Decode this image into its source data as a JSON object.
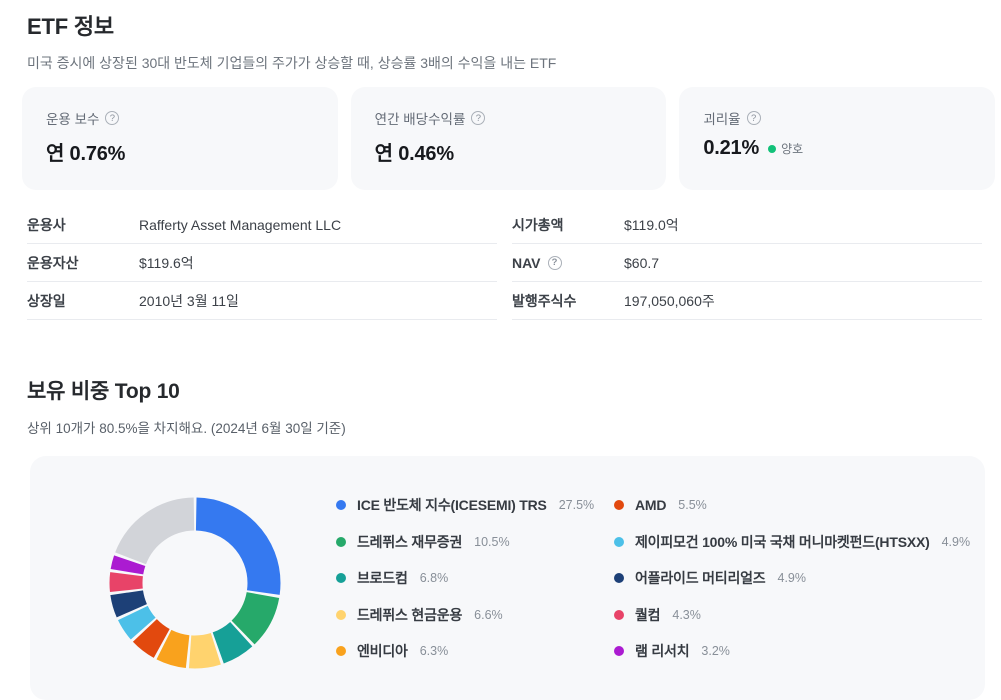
{
  "page": {
    "title": "ETF 정보",
    "subtitle": "미국 증시에 상장된 30대 반도체 기업들의 주가가 상승할 때, 상승률 3배의 수익을 내는 ETF"
  },
  "stat_cards": [
    {
      "label": "운용 보수",
      "value": "연 0.76%"
    },
    {
      "label": "연간 배당수익률",
      "value": "연 0.46%"
    },
    {
      "label": "괴리율",
      "value": "0.21%",
      "badge": {
        "text": "양호",
        "color": "#12c179"
      }
    }
  ],
  "info_table": {
    "left": [
      {
        "label": "운용사",
        "value": "Rafferty Asset Management LLC"
      },
      {
        "label": "운용자산",
        "value": "$119.6억"
      },
      {
        "label": "상장일",
        "value": "2010년 3월 11일"
      }
    ],
    "right": [
      {
        "label": "시가총액",
        "value": "$119.0억"
      },
      {
        "label": "NAV",
        "value": "$60.7",
        "has_help": true
      },
      {
        "label": "발행주식수",
        "value": "197,050,060주"
      }
    ]
  },
  "holdings": {
    "title": "보유 비중 Top 10",
    "subtitle": "상위 10개가 80.5%을 차지해요. (2024년 6월 30일 기준)"
  },
  "chart_data": {
    "type": "pie",
    "donut": true,
    "title": "보유 비중 Top 10",
    "legend_position": "right",
    "start_angle_deg": 0,
    "direction": "clockwise",
    "labels": [
      "ICE 반도체 지수(ICESEMI) TRS",
      "드레퓌스 재무증권",
      "브로드컴",
      "드레퓌스 현금운용",
      "엔비디아",
      "AMD",
      "제이피모건 100% 미국 국채 머니마켓펀드(HTSXX)",
      "어플라이드 머티리얼즈",
      "퀄컴",
      "램 리서치"
    ],
    "values": [
      27.5,
      10.5,
      6.8,
      6.6,
      6.3,
      5.5,
      4.9,
      4.9,
      4.3,
      3.2
    ],
    "colors": [
      "#3579f0",
      "#26a96a",
      "#16a097",
      "#ffd36e",
      "#f9a21d",
      "#e2490e",
      "#4cc0e8",
      "#1d4077",
      "#e84368",
      "#ab1bd1"
    ],
    "remainder": {
      "value": 19.5,
      "color": "#d2d4d9"
    }
  }
}
